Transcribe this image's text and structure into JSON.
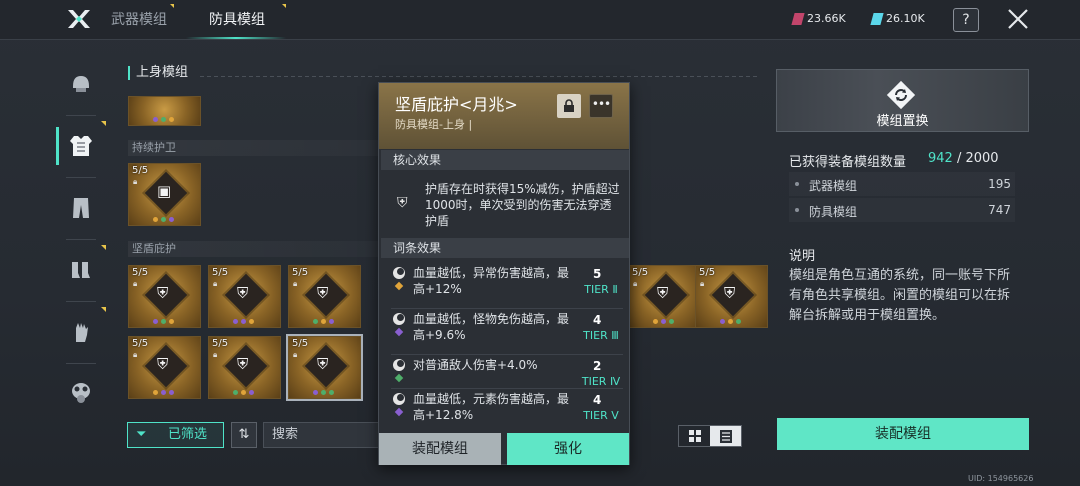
{
  "tabs": [
    {
      "label": "武器模组",
      "active": false
    },
    {
      "label": "防具模组",
      "active": true
    }
  ],
  "currency": [
    {
      "icon": "red-crystal-icon",
      "value": "23.66K",
      "color": "#c2456b"
    },
    {
      "icon": "teal-crystal-icon",
      "value": "26.10K",
      "color": "#5bd7ea"
    }
  ],
  "help_label": "?",
  "sidebar": {
    "items": [
      {
        "icon": "helmet-icon",
        "active": false
      },
      {
        "icon": "chest-armor-icon",
        "active": true
      },
      {
        "icon": "pants-icon",
        "active": false
      },
      {
        "icon": "boots-icon",
        "active": false
      },
      {
        "icon": "gloves-icon",
        "active": false
      },
      {
        "icon": "gas-mask-icon",
        "active": false
      }
    ]
  },
  "modules": {
    "title": "上身模组",
    "sections": [
      {
        "label": "持续护卫",
        "cards": [
          {
            "count": "5/5"
          }
        ]
      },
      {
        "label": "坚盾庇护",
        "cards": [
          {
            "count": "5/5"
          },
          {
            "count": "5/5"
          },
          {
            "count": "5/5"
          },
          {
            "count": "5/5"
          },
          {
            "count": "5/5"
          },
          {
            "count": "5/5"
          },
          {
            "count": "5/5"
          },
          {
            "count": "5/5"
          }
        ]
      }
    ],
    "top_partial_card": {
      "count": ""
    }
  },
  "filter": {
    "label": "已筛选",
    "sort_icon": "sort-icon",
    "search_placeholder": "搜索"
  },
  "popup": {
    "name": "坚盾庇护<月兆>",
    "subtitle": "防具模组-上身 |",
    "core_header": "核心效果",
    "core_text": "护盾存在时获得15%减伤，护盾超过1000时，单次受到的伤害无法穿透护盾",
    "attr_header": "词条效果",
    "attributes": [
      {
        "text": "血量越低，异常伤害越高，最高+12%",
        "level": "5",
        "tier": "TIER Ⅱ",
        "gem_color": "#e0a43a"
      },
      {
        "text": "血量越低，怪物免伤越高，最高+9.6%",
        "level": "4",
        "tier": "TIER Ⅲ",
        "gem_color": "#8a5fd0"
      },
      {
        "text": "对普通敌人伤害+4.0%",
        "level": "2",
        "tier": "TIER Ⅳ",
        "gem_color": "#4fae6a"
      },
      {
        "text": "血量越低，元素伤害越高，最高+12.8%",
        "level": "4",
        "tier": "TIER Ⅴ",
        "gem_color": "#8a5fd0"
      }
    ],
    "equip_label": "装配模组",
    "upgrade_label": "强化"
  },
  "right_panel": {
    "replace_label": "模组置换",
    "stats_title": "已获得装备模组数量",
    "stats_current": "942",
    "stats_total": "/ 2000",
    "rows": [
      {
        "label": "武器模组",
        "value": "195"
      },
      {
        "label": "防具模组",
        "value": "747"
      }
    ],
    "note_head": "说明",
    "note_body": "模组是角色互通的系统，同一账号下所有角色共享模组。闲置的模组可以在拆解台拆解或用于模组置换。",
    "equip_label": "装配模组"
  },
  "uid": "UID: 154965626",
  "colors": {
    "accent": "#4fe3c8",
    "gold": "#c99b45",
    "button_teal": "#5fe6c6"
  }
}
